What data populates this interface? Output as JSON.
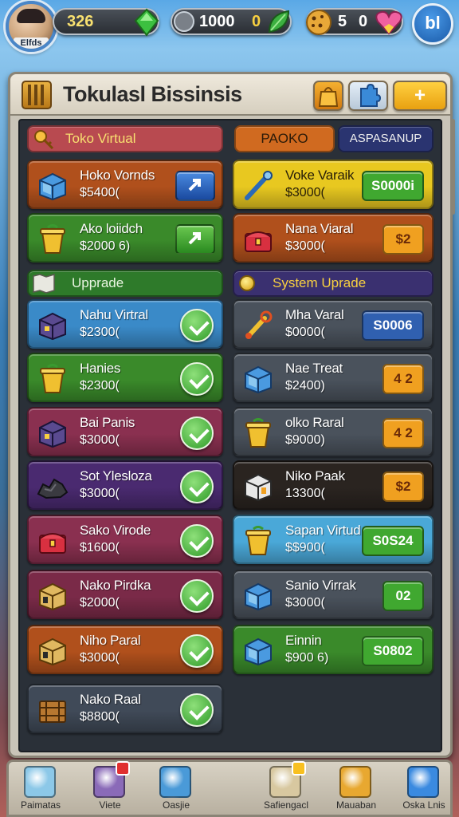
{
  "top": {
    "avatar_tag": "Elfds",
    "res1_value": "326",
    "res2_value": "1000",
    "res2_suffix": "0",
    "res3_value": "5",
    "res3_suffix": "0",
    "home_label": "bl"
  },
  "panel": {
    "title": "Tokulasl Bissinsis",
    "add_label": "+"
  },
  "sections": {
    "left_header": "Toko Virtual",
    "right_tab1": "PAOKO",
    "right_tab2": "ASPASANUP",
    "left_upgrade": "Upprade",
    "right_upgrade": "System Uprade"
  },
  "left_items": [
    {
      "name": "Hoko Vornds",
      "price": "$5400(",
      "color": "#b0501c",
      "icon": "blue-box-icon"
    },
    {
      "name": "Ako loiidch",
      "price": "$2000 6)",
      "color": "#3a8a2a",
      "icon": "yellow-bin-icon"
    },
    {
      "name": "Nahu Virtral",
      "price": "$2300(",
      "color": "#3a8ac8",
      "icon": "purple-box-icon"
    },
    {
      "name": "Hanies",
      "price": "$2300(",
      "color": "#3a8a2a",
      "icon": "yellow-bin-icon"
    },
    {
      "name": "Bai Panis",
      "price": "$3000(",
      "color": "#8a3050",
      "icon": "purple-box-icon"
    },
    {
      "name": "Sot Ylesloza",
      "price": "$3000(",
      "color": "#4a2a70",
      "icon": "rock-icon"
    },
    {
      "name": "Sako Virode",
      "price": "$1600(",
      "color": "#8a3050",
      "icon": "red-chest-icon"
    },
    {
      "name": "Nako Pirdka",
      "price": "$2000(",
      "color": "#7a2a48",
      "icon": "tan-box-icon"
    },
    {
      "name": "Niho Paral",
      "price": "$3000(",
      "color": "#b0501c",
      "icon": "tan-box-icon"
    },
    {
      "name": "Nako Raal",
      "price": "$8800(",
      "color": "#404a58",
      "icon": "crate-icon"
    }
  ],
  "right_items": [
    {
      "name": "Voke Varaik",
      "price": "$3000(",
      "color": "#e8c820",
      "icon": "blue-tool-icon",
      "action": "S0000i",
      "action_color": "#40a830"
    },
    {
      "name": "Nana Viaral",
      "price": "$3000(",
      "color": "#b0501c",
      "icon": "red-chest-icon",
      "action": "$2",
      "action_color": "#f0a020"
    },
    {
      "name": "Mha Varal",
      "price": "$0000(",
      "color": "#4a525c",
      "icon": "yellow-tool-icon",
      "action": "S0006",
      "action_color": "#3060b0"
    },
    {
      "name": "Nae Treat",
      "price": "$2400)",
      "color": "#4a525c",
      "icon": "blue-box-icon",
      "action": "4 2",
      "action_color": "#f0a020"
    },
    {
      "name": "olko Raral",
      "price": "$9000)",
      "color": "#4a525c",
      "icon": "yellow-bin-icon",
      "action": "4 2",
      "action_color": "#f0a020"
    },
    {
      "name": "Niko Paak",
      "price": "13300(",
      "color": "#2a2420",
      "icon": "white-box-icon",
      "action": "$2",
      "action_color": "#f0a020"
    },
    {
      "name": "Sapan Virtud",
      "price": "$$900(",
      "color": "#4aa8d8",
      "icon": "yellow-bin-icon",
      "action": "S0S24",
      "action_color": "#40a830"
    },
    {
      "name": "Sanio Virrak",
      "price": "$3000(",
      "color": "#4a525c",
      "icon": "blue-box-icon",
      "action": "02",
      "action_color": "#40a830"
    },
    {
      "name": "Einnin",
      "price": "$900 6)",
      "color": "#3a8a2a",
      "icon": "blue-box-icon",
      "action": "S0802",
      "action_color": "#40a830"
    }
  ],
  "bottom_nav": [
    {
      "label": "Paimatas",
      "icon": "backpack-icon",
      "color": "#8cc8e8"
    },
    {
      "label": "Viete",
      "icon": "box-icon",
      "color": "#8a6ab8"
    },
    {
      "label": "Oasjie",
      "icon": "cube-icon",
      "color": "#4a9ad8"
    },
    {
      "label": "Safiengacl",
      "icon": "tools-icon",
      "color": "#d8c8a0"
    },
    {
      "label": "Mauaban",
      "icon": "chest-icon",
      "color": "#e8a830"
    },
    {
      "label": "Oska Lnis",
      "icon": "map-icon",
      "color": "#3a8ae0"
    }
  ],
  "colors": {
    "left_header": "#b84a50",
    "right_tab1": "#d06a20",
    "right_tab2": "#2a3470",
    "left_upgrade": "#2e7a2a",
    "right_upgrade": "#3a3070"
  }
}
